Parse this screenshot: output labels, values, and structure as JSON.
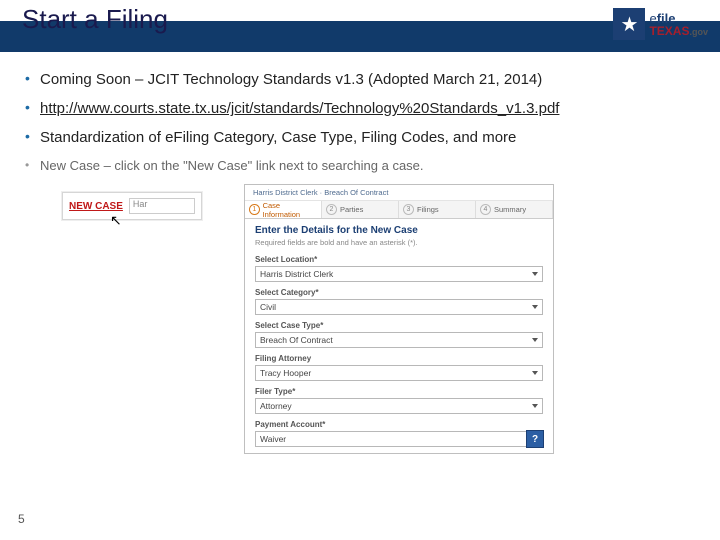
{
  "header": {
    "title": "Start a Filing"
  },
  "logo": {
    "line1_a": "e",
    "line1_b": "file",
    "line2": "TEXAS",
    "line3": ".gov"
  },
  "bullets": {
    "b1": "Coming Soon – JCIT Technology Standards v1.3 (Adopted March 21, 2014)",
    "b2_link": "http://www.courts.state.tx.us/jcit/standards/Technology%20Standards_v1.3.pdf",
    "b3": "Standardization of eFiling Category, Case Type, Filing Codes, and more",
    "b4": "New Case – click on the \"New Case\" link next to searching a case."
  },
  "newcase": {
    "link": "NEW CASE",
    "search_hint": "Har"
  },
  "form": {
    "breadcrumb": "Harris District Clerk · Breach Of Contract",
    "tabs": {
      "t1": "Case Information",
      "t2": "Parties",
      "t3": "Filings",
      "t4": "Summary"
    },
    "heading": "Enter the Details for the New Case",
    "sub": "Required fields are bold and have an asterisk (*).",
    "fields": {
      "loc_l": "Select Location*",
      "loc_v": "Harris District Clerk",
      "cat_l": "Select Category*",
      "cat_v": "Civil",
      "ct_l": "Select Case Type*",
      "ct_v": "Breach Of Contract",
      "att_l": "Filing Attorney",
      "att_v": "Tracy Hooper",
      "ft_l": "Filer Type*",
      "ft_v": "Attorney",
      "pay_l": "Payment Account*",
      "pay_v": "Waiver"
    }
  },
  "page": "5"
}
